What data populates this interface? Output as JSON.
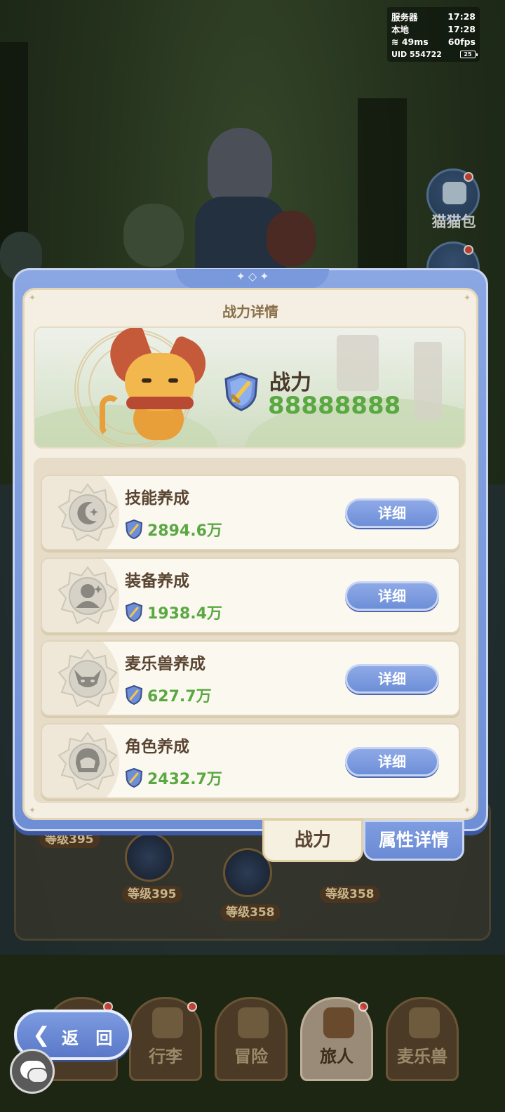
{
  "status": {
    "server_label": "服务器",
    "server_time": "17:28",
    "local_label": "本地",
    "local_time": "17:28",
    "ping": "49ms",
    "fps": "60fps",
    "uid": "UID 554722",
    "battery": "25"
  },
  "side": {
    "cat_bag_label": "猫猫包"
  },
  "background_levels": [
    "等级395",
    "等级395",
    "等级358",
    "等级358"
  ],
  "modal": {
    "title": "战力详情",
    "power_label": "战力",
    "power_value": "88888888",
    "rows": [
      {
        "title": "技能养成",
        "value": "2894.6万",
        "button": "详细",
        "icon": "moon-star-icon"
      },
      {
        "title": "装备养成",
        "value": "1938.4万",
        "button": "详细",
        "icon": "equipment-figure-icon"
      },
      {
        "title": "麦乐兽养成",
        "value": "627.7万",
        "button": "详细",
        "icon": "cat-face-icon"
      },
      {
        "title": "角色养成",
        "value": "2432.7万",
        "button": "详细",
        "icon": "character-head-icon"
      }
    ],
    "tabs": {
      "power": "战力",
      "attributes": "属性详情"
    }
  },
  "nav": {
    "back_label": "返 回",
    "tabs": [
      {
        "label": "行李",
        "icon": "luggage-icon"
      },
      {
        "label": "冒险",
        "icon": "crossed-swords-icon"
      },
      {
        "label": "旅人",
        "icon": "traveler-icon"
      },
      {
        "label": "麦乐兽",
        "icon": "melee-beast-icon"
      }
    ]
  },
  "colors": {
    "accent_blue": "#7f9de0",
    "value_green": "#5aa842",
    "panel_cream": "#f4efe2"
  }
}
